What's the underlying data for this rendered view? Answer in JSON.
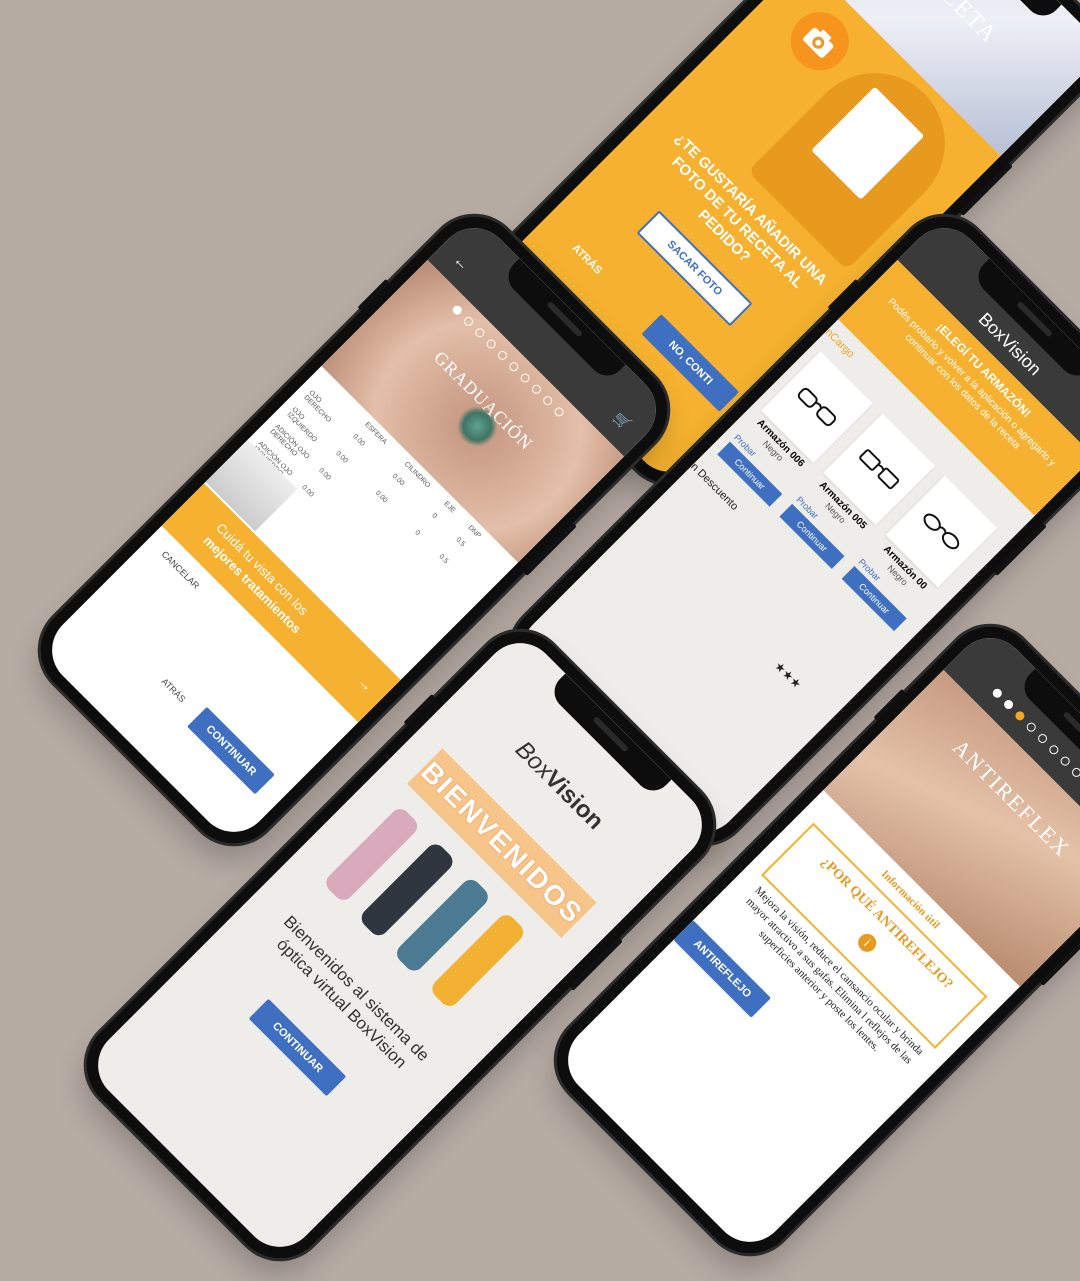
{
  "background_color": "#b7aca4",
  "accent_orange": "#f5b12f",
  "accent_blue": "#3f6fc0",
  "phone_receta": {
    "header_title": "RECETA",
    "question": "¿TE GUSTARÍA AÑADIR UNA FOTO DE TU RECETA AL PEDIDO?",
    "photo_button": "SACAR FOTO",
    "back_label": "ATRÁS",
    "no_button": "NO, CONTI",
    "camera_icon": "camera-icon"
  },
  "phone_graduacion": {
    "title": "GRADUACIÓN",
    "columns": [
      "ESFERA",
      "CILINDRO",
      "EJE",
      "DNP"
    ],
    "rows": [
      {
        "label": "OJO DERECHO",
        "esfera": "0.00",
        "cilindro": "0.00",
        "eje": "0",
        "dnp": "0.5"
      },
      {
        "label": "OJO IZQUIERDO",
        "esfera": "0.00",
        "cilindro": "0.00",
        "eje": "0",
        "dnp": "0.5"
      },
      {
        "label": "ADICIÓN OJO DERECHO",
        "esfera": "0.00",
        "cilindro": "",
        "eje": "",
        "dnp": ""
      },
      {
        "label": "ADICIÓN OJO IZQUIERDO",
        "esfera": "0.00",
        "cilindro": "",
        "eje": "",
        "dnp": ""
      }
    ],
    "promo_line1": "Cuidá tu vista con los",
    "promo_line2": "mejores tratamientos",
    "cancel_label": "CANCELAR",
    "back_label": "ATRÁS",
    "continue_button": "CONTINUAR",
    "back_icon": "back-arrow-icon",
    "cart_icon": "cart-icon"
  },
  "phone_armazon": {
    "brand": "BoxVision",
    "banner_title": "¡ELEGÍ TU ARMAZÓN!",
    "banner_text": "Podés probarlo y volver a la aplicación o agregarlo y continuar con los datos de la receta",
    "section_1": "nCargo",
    "section_2": "n Descuento",
    "frames": [
      {
        "name": "Armazón 006",
        "color": "Negro"
      },
      {
        "name": "Armazón 005",
        "color": "Negro"
      },
      {
        "name": "Armazón 00",
        "color": "Negro"
      }
    ],
    "try_label": "Probar",
    "continue_label": "Continuar",
    "rating": "★★★"
  },
  "phone_bienvenidos": {
    "brand_box": "Box",
    "brand_vision": "Vision",
    "banner": "BIENVENIDOS",
    "welcome_text": "Bienvenidos al sistema de óptica virtual BoxVision",
    "continue_button": "CONTINUAR"
  },
  "phone_antireflex": {
    "title": "ANTIREFLEX",
    "info_label": "Información útil",
    "question": "¿POR QUÉ ANTIREFLEJO?",
    "body": "Mejora la visión, reduce el cansancio ocular y brinda mayor atractivo a sus gafas. Elimina l reflejos de las superficies anterior y poste los lentes.",
    "button": "ANTIREFLEJO"
  }
}
